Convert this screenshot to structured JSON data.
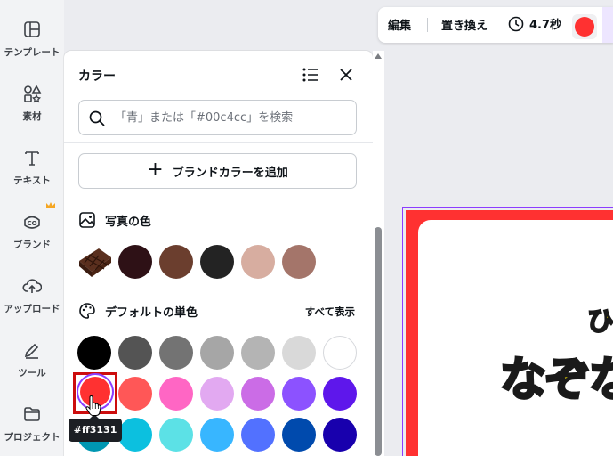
{
  "rail": {
    "items": [
      {
        "label": "テンプレート",
        "icon": "template-icon"
      },
      {
        "label": "素材",
        "icon": "elements-icon"
      },
      {
        "label": "テキスト",
        "icon": "text-icon"
      },
      {
        "label": "ブランド",
        "icon": "brand-icon"
      },
      {
        "label": "アップロード",
        "icon": "upload-icon"
      },
      {
        "label": "ツール",
        "icon": "tools-icon"
      },
      {
        "label": "プロジェクト",
        "icon": "folder-icon"
      }
    ]
  },
  "panel": {
    "title": "カラー",
    "search_placeholder": "「青」または「#00c4cc」を検索",
    "add_brand_label": "ブランドカラーを追加",
    "photo_section": {
      "title": "写真の色",
      "colors": [
        "#2e1116",
        "#6b3e2e",
        "#232323",
        "#d7ada0",
        "#a4756a"
      ]
    },
    "default_section": {
      "title": "デフォルトの単色",
      "show_all": "すべて表示",
      "rows": [
        [
          "#000000",
          "#545454",
          "#737373",
          "#a6a6a6",
          "#b4b4b4",
          "#d9d9d9",
          "#ffffff"
        ],
        [
          "#ff3131",
          "#ff5757",
          "#ff66c4",
          "#e2a9f1",
          "#cb6ce6",
          "#8c52ff",
          "#5e17eb"
        ],
        [
          "#0097b2",
          "#0cc0df",
          "#5ce1e6",
          "#38b6ff",
          "#5271ff",
          "#004aad",
          "#1800ad"
        ]
      ]
    },
    "selected_color": "#ff3131",
    "tooltip": "#ff3131"
  },
  "toolbar": {
    "edit_label": "編集",
    "replace_label": "置き換え",
    "duration": "4.7秒",
    "current_color": "#ff3131"
  },
  "canvas": {
    "text_small": "ひ",
    "text_big": "なぞな"
  }
}
